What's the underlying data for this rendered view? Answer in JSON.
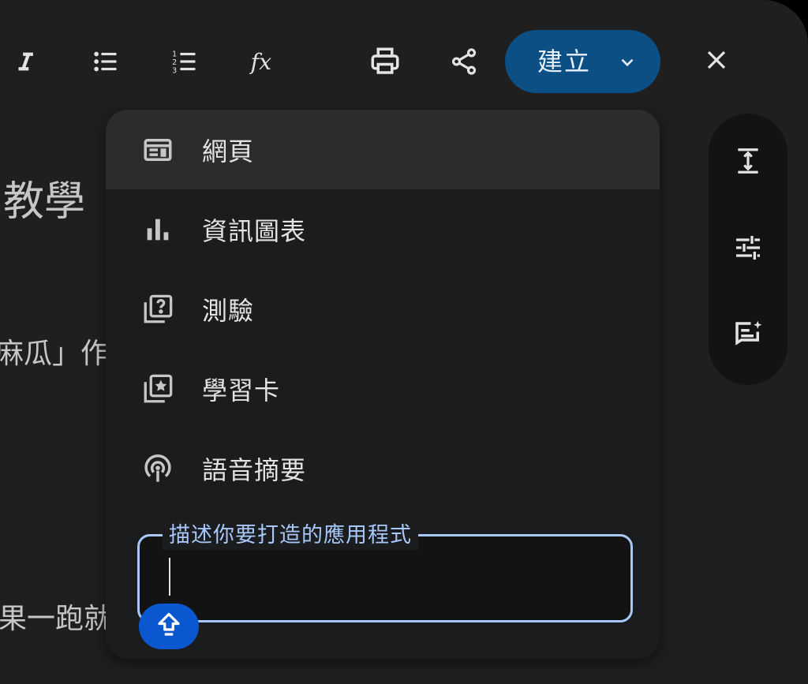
{
  "toolbar": {
    "italic_icon": "italic-icon",
    "bullets_icon": "bulleted-list-icon",
    "numbered_icon": "numbered-list-icon",
    "formula_icon": "formula-icon",
    "print_icon": "print-icon",
    "share_icon": "share-icon",
    "create_label": "建立",
    "close_icon": "close-icon",
    "accent": "#0b4f85"
  },
  "document": {
    "heading_fragment": "教學",
    "line1_fragment": "麻瓜」作",
    "line2_fragment": "果一跑就"
  },
  "menu": {
    "items": [
      {
        "label": "網頁",
        "icon": "web-page-icon"
      },
      {
        "label": "資訊圖表",
        "icon": "bar-chart-icon"
      },
      {
        "label": "測驗",
        "icon": "quiz-icon"
      },
      {
        "label": "學習卡",
        "icon": "flashcards-icon"
      },
      {
        "label": "語音摘要",
        "icon": "podcast-icon"
      }
    ],
    "prompt_label": "描述你要打造的應用程式",
    "prompt_value": "",
    "send_icon": "upload-arrow-icon"
  },
  "rail": {
    "icons": [
      "expand-height-icon",
      "tune-icon",
      "ai-notes-icon"
    ]
  },
  "colors": {
    "background": "#1f1f1f",
    "menu": "#1b1c1e",
    "focus": "#a8c7fa",
    "send": "#0b57d0"
  }
}
